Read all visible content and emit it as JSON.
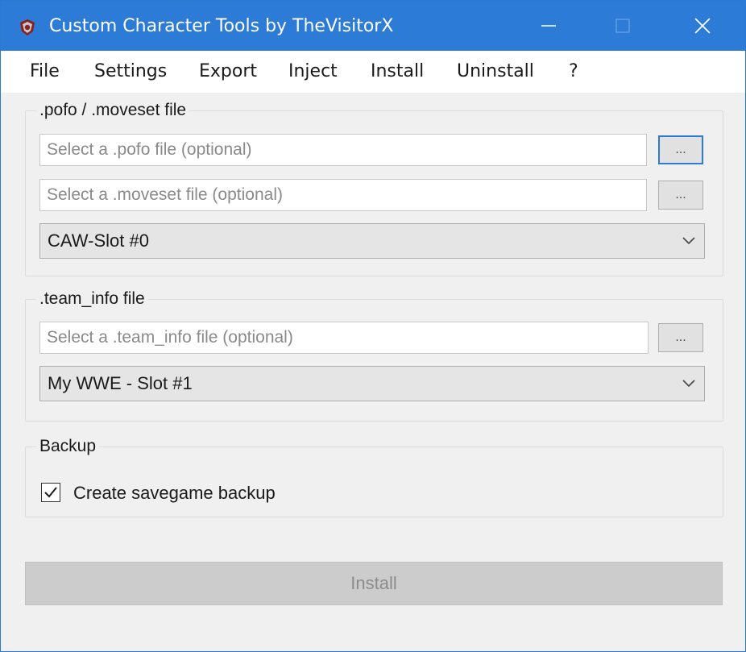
{
  "window": {
    "title": "Custom Character Tools by TheVisitorX",
    "icon": "app-logo-icon",
    "controls": [
      "minimize-icon",
      "maximize-icon",
      "close-icon"
    ]
  },
  "menu": {
    "items": [
      "File",
      "Settings",
      "Export",
      "Inject",
      "Install",
      "Uninstall",
      "?"
    ]
  },
  "pofo_group": {
    "legend": ".pofo / .moveset file",
    "pofo_placeholder": "Select a .pofo file (optional)",
    "moveset_placeholder": "Select a .moveset file (optional)",
    "browse_label": "...",
    "slot_selected": "CAW-Slot #0"
  },
  "team_group": {
    "legend": ".team_info file",
    "team_placeholder": "Select a .team_info file (optional)",
    "browse_label": "...",
    "slot_selected": "My WWE - Slot #1"
  },
  "backup_group": {
    "legend": "Backup",
    "checkbox_label": "Create savegame backup",
    "checked": true
  },
  "install_button": {
    "label": "Install",
    "enabled": false
  },
  "colors": {
    "titlebar": "#2b7bd7",
    "window_bg": "#f0f0f0",
    "focus_border": "#2b7bd7"
  }
}
